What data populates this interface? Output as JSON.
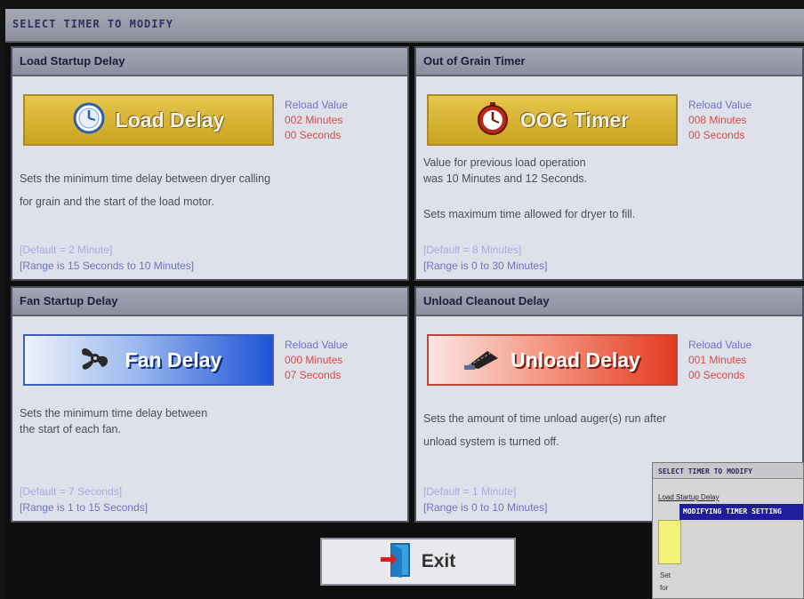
{
  "header": {
    "title": "SELECT TIMER TO MODIFY"
  },
  "panels": [
    {
      "title": "Load Startup Delay",
      "button_label": "Load Delay",
      "icon": "clock-icon",
      "color": "#d4b43a",
      "reload_title": "Reload Value",
      "reload_minutes": "002 Minutes",
      "reload_seconds": "00 Seconds",
      "desc1": "Sets the minimum time delay between dryer calling",
      "desc2": "for grain and the start of the load motor.",
      "default": "[Default = 2 Minute]",
      "range": "[Range is 15 Seconds to 10 Minutes]"
    },
    {
      "title": "Out of Grain Timer",
      "button_label": "OOG Timer",
      "icon": "stopwatch-icon",
      "color": "#d4b43a",
      "reload_title": "Reload Value",
      "reload_minutes": "008 Minutes",
      "reload_seconds": "00 Seconds",
      "prev1": "Value for previous load operation",
      "prev2": "was 10 Minutes and 12 Seconds.",
      "desc1": "Sets maximum time allowed for dryer to fill.",
      "default": "[Default = 8 Minutes]",
      "range": "[Range is 0 to 30 Minutes]"
    },
    {
      "title": "Fan Startup Delay",
      "button_label": "Fan Delay",
      "icon": "fan-icon",
      "color": "#2a5fd8",
      "reload_title": "Reload Value",
      "reload_minutes": "000 Minutes",
      "reload_seconds": "07 Seconds",
      "desc1": "Sets the minimum time delay between",
      "desc2": "the start of each fan.",
      "default": "[Default = 7 Seconds]",
      "range": "[Range is 1 to 15 Seconds]"
    },
    {
      "title": "Unload Cleanout Delay",
      "button_label": "Unload Delay",
      "icon": "auger-icon",
      "color": "#e44028",
      "reload_title": "Reload Value",
      "reload_minutes": "001 Minutes",
      "reload_seconds": "00 Seconds",
      "desc1": "Sets the amount of time unload auger(s) run after",
      "desc2": "unload system is turned off.",
      "default": "[Default = 1 Minute]",
      "range": "[Range is 0 to 10 Minutes]"
    }
  ],
  "exit": {
    "label": "Exit",
    "icon": "door-exit-icon"
  },
  "inset": {
    "title": "SELECT TIMER TO MODIFY",
    "tab": "Load Startup Delay",
    "bar": "MODIFYING TIMER SETTING",
    "side1": "Set",
    "side2": "for"
  }
}
